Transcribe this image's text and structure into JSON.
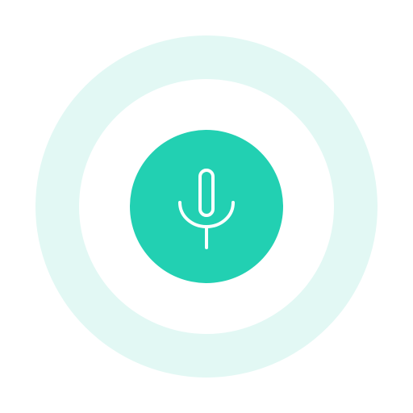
{
  "voice_input": {
    "button_icon": "microphone-icon",
    "button_color": "#22d0b2",
    "ring_color": "#e2f8f4",
    "background_color": "#ffffff",
    "icon_color": "#ffffff"
  }
}
